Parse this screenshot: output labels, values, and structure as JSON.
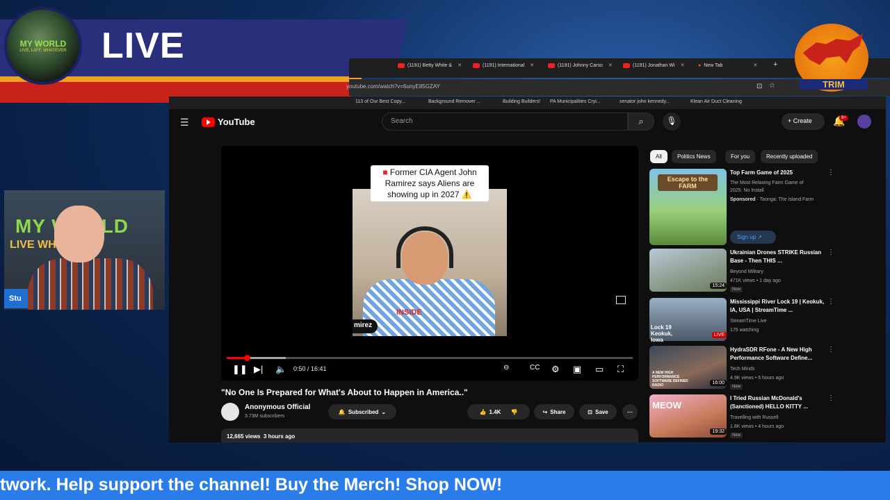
{
  "overlay": {
    "live_label": "LIVE",
    "logo_text": "MY WORLD",
    "logo_subtext": "LIVE, LAFF, WHATEVER",
    "trim_label": "TRIM",
    "ticker": "twork. Help support the channel! Buy the Merch! Shop NOW!",
    "webcam": {
      "name_label": "Stu",
      "bg_title": "MY WORLD",
      "bg_subtitle": "LIVE   WHATEVER"
    }
  },
  "browser": {
    "tabs": [
      {
        "label": "(1191) Betty White &"
      },
      {
        "label": "(1191) International"
      },
      {
        "label": "(1191) Johnny Carso"
      },
      {
        "label": "(1191) Jonathan Wi"
      },
      {
        "label": "New Tab"
      }
    ],
    "url": "youtube.com/watch?v=6unyE85GZAY",
    "bookmarks": [
      "113 of Our Best Copy...",
      "Background Remover ...",
      "Building Builders!",
      "PA Municipalities Cryi...",
      "senator john kennedy...",
      "Klean Air Duct Cleaning"
    ]
  },
  "youtube": {
    "logo": "YouTube",
    "search_placeholder": "Search",
    "create_label": "Create",
    "notif_count": "9+",
    "video": {
      "caption": "Former CIA Agent John Ramirez says Aliens are showing up in 2027 ⚠️",
      "name_tag": "mirez",
      "overlay_word": "INSIDE",
      "time": "0:50 / 16:41",
      "progress": 0.05,
      "title": "\"No One Is Prepared for What's About to Happen in America..\"",
      "channel": "Anonymous Official",
      "subscribers": "3.73M subscribers",
      "subscribed_label": "Subscribed",
      "likes": "1.4K",
      "share_label": "Share",
      "save_label": "Save",
      "views": "12,665 views",
      "ago": "3 hours ago"
    },
    "chips": [
      "All",
      "Politics News",
      "For you",
      "Recently uploaded"
    ],
    "recommendations": [
      {
        "title": "Top Farm Game of 2025",
        "line1": "The Most Relaxing Farm Game of 2025. No Install",
        "sponsored": "Sponsored",
        "advertiser": "Taonga: The Island Farm",
        "cta": "Sign up",
        "thumb_text": "Escape to the FARM"
      },
      {
        "title": "Ukrainian Drones STRIKE Russian Base - Then THIS ...",
        "channel": "Beyond Military",
        "meta": "471K views • 1 day ago",
        "badge": "New",
        "duration": "15:24"
      },
      {
        "title": "Mississippi River Lock 19 | Keokuk, IA, USA | StreamTime ...",
        "channel": "StreamTime Live",
        "meta": "175 watching",
        "live": "LIVE",
        "thumb_text": "Lock 19 Keokuk, Iowa"
      },
      {
        "title": "HydraSDR RFone - A New High Performance Software Define...",
        "channel": "Tech Minds",
        "meta": "4.9K views • 6 hours ago",
        "badge": "New",
        "duration": "16:00",
        "thumb_text": "A NEW HIGH PERFORMANCE SOFTWARE DEFINED RADIO"
      },
      {
        "title": "I Tried Russian McDonald's (Sanctioned) HELLO KITTY ...",
        "channel": "Travelling with Russell",
        "meta": "1.8K views • 4 hours ago",
        "badge": "New",
        "duration": "19:32",
        "thumb_text": "MEOW"
      }
    ]
  }
}
